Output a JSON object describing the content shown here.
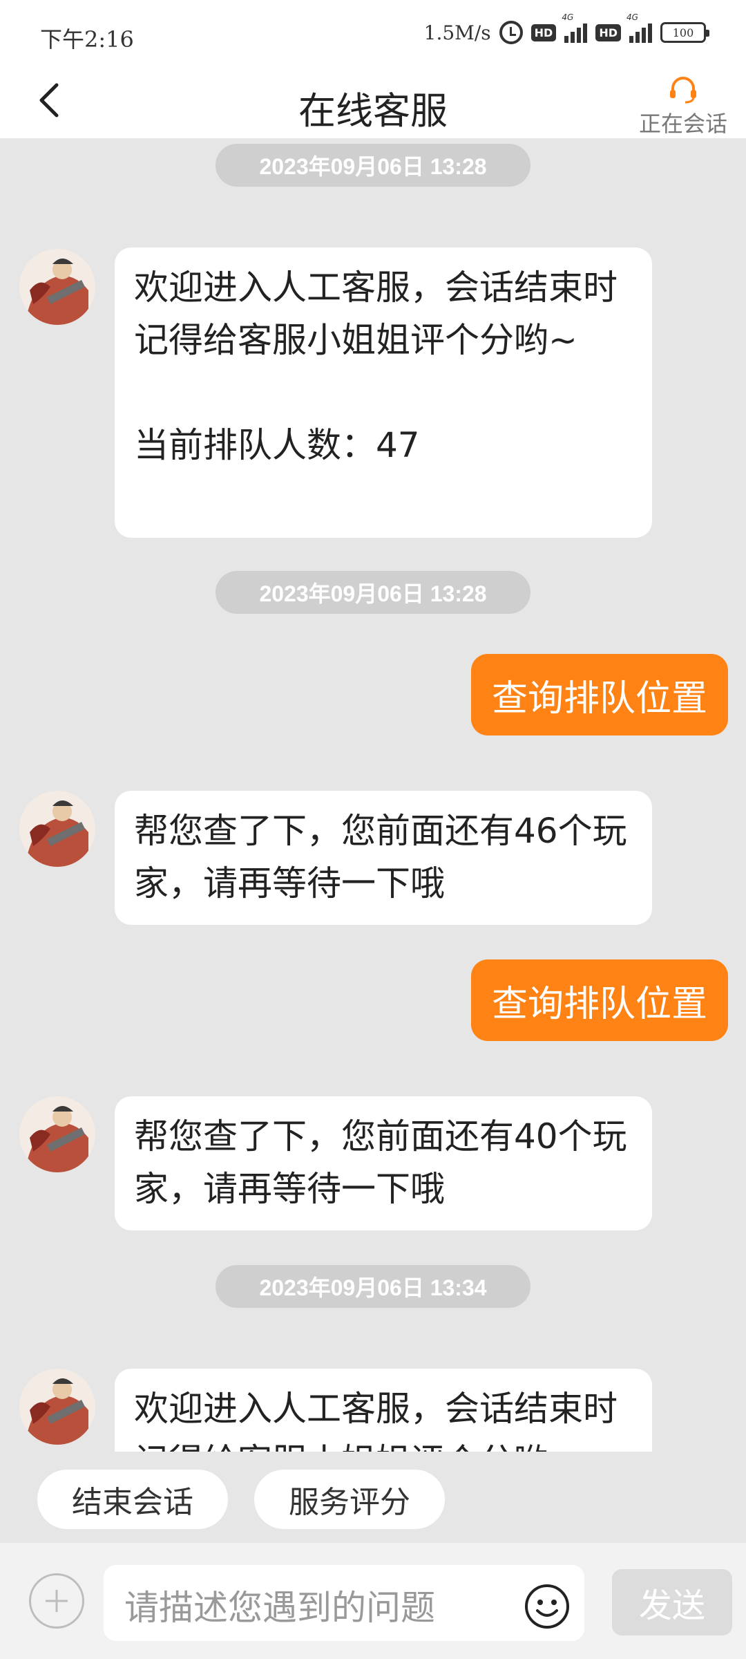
{
  "status_bar": {
    "time": "下午2:16",
    "speed": "1.5M/s",
    "hd1": "HD",
    "hd2": "HD",
    "net1": "4G",
    "net2": "4G",
    "battery": "100"
  },
  "header": {
    "title": "在线客服",
    "status_label": "正在会话",
    "accent_color": "#ff8214"
  },
  "chat": {
    "timestamps": [
      "2023年09月06日 13:28",
      "2023年09月06日 13:28",
      "2023年09月06日 13:34"
    ],
    "agent_messages": [
      "欢迎进入人工客服，会话结束时记得给客服小姐姐评个分哟~\n\n当前排队人数：47",
      "帮您查了下，您前面还有46个玩家，请再等待一下哦",
      "帮您查了下，您前面还有40个玩家，请再等待一下哦",
      "欢迎进入人工客服，会话结束时记得给客服小姐姐评个分哟"
    ],
    "user_messages": [
      "查询排队位置",
      "查询排队位置"
    ]
  },
  "quick_actions": {
    "end_session": "结束会话",
    "rate_service": "服务评分"
  },
  "input_bar": {
    "placeholder": "请描述您遇到的问题",
    "send_label": "发送"
  }
}
